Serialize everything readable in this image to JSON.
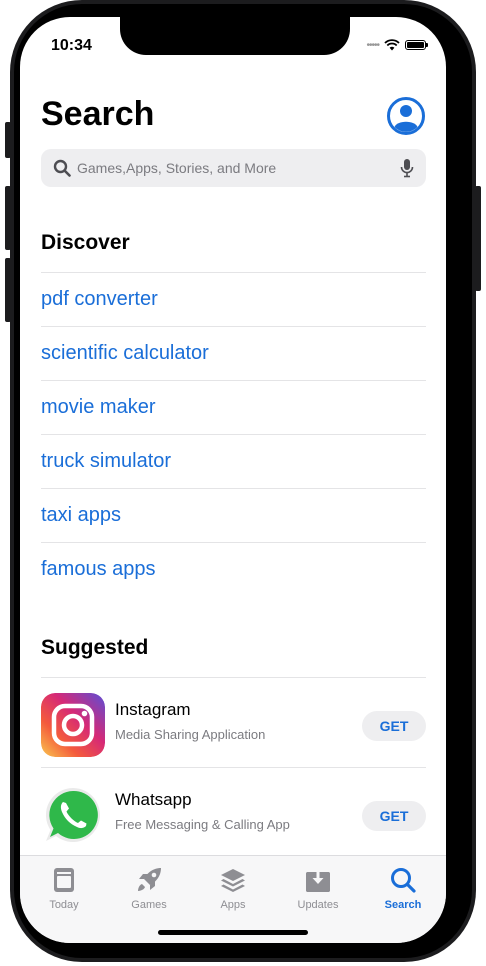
{
  "status_bar": {
    "time": "10:34"
  },
  "header": {
    "title": "Search"
  },
  "search": {
    "placeholder": "Games,Apps, Stories, and More"
  },
  "discover": {
    "title": "Discover",
    "items": [
      {
        "label": "pdf converter"
      },
      {
        "label": "scientific calculator"
      },
      {
        "label": "movie maker"
      },
      {
        "label": "truck simulator"
      },
      {
        "label": "taxi apps"
      },
      {
        "label": "famous apps"
      }
    ]
  },
  "suggested": {
    "title": "Suggested",
    "apps": [
      {
        "name": "Instagram",
        "description": "Media Sharing Application",
        "button": "GET",
        "icon": "instagram-icon"
      },
      {
        "name": "Whatsapp",
        "description": "Free Messaging & Calling App",
        "button": "GET",
        "icon": "whatsapp-icon"
      }
    ]
  },
  "tab_bar": {
    "tabs": [
      {
        "label": "Today",
        "icon": "today-icon"
      },
      {
        "label": "Games",
        "icon": "rocket-icon"
      },
      {
        "label": "Apps",
        "icon": "layers-icon"
      },
      {
        "label": "Updates",
        "icon": "download-icon"
      },
      {
        "label": "Search",
        "icon": "search-icon",
        "active": true
      }
    ]
  },
  "colors": {
    "accent": "#1a6ed8",
    "secondary_text": "#7b7b80",
    "search_background": "#eeeef0",
    "tab_inactive": "#8e8e93"
  }
}
